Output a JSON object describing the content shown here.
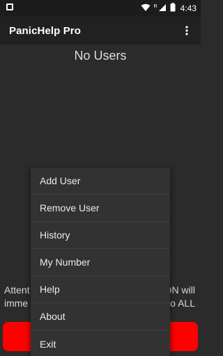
{
  "status_bar": {
    "time": "4:43",
    "network_badge": "R",
    "icons": [
      "notification-icon",
      "wifi-icon",
      "signal-icon",
      "battery-icon"
    ]
  },
  "app_bar": {
    "title": "PanicHelp Pro",
    "overflow_icon": "more-vert-icon"
  },
  "main": {
    "empty_message": "No Users",
    "attention_line1_left": "Attent",
    "attention_line1_right": "ON will",
    "attention_line2_left": "imme",
    "attention_line2_right": "to ALL",
    "panic_button_color": "#ff0000"
  },
  "menu": {
    "items": [
      {
        "label": "Add User"
      },
      {
        "label": "Remove User"
      },
      {
        "label": "History"
      },
      {
        "label": "My Number"
      },
      {
        "label": "Help"
      },
      {
        "label": "About"
      },
      {
        "label": "Exit"
      }
    ]
  }
}
